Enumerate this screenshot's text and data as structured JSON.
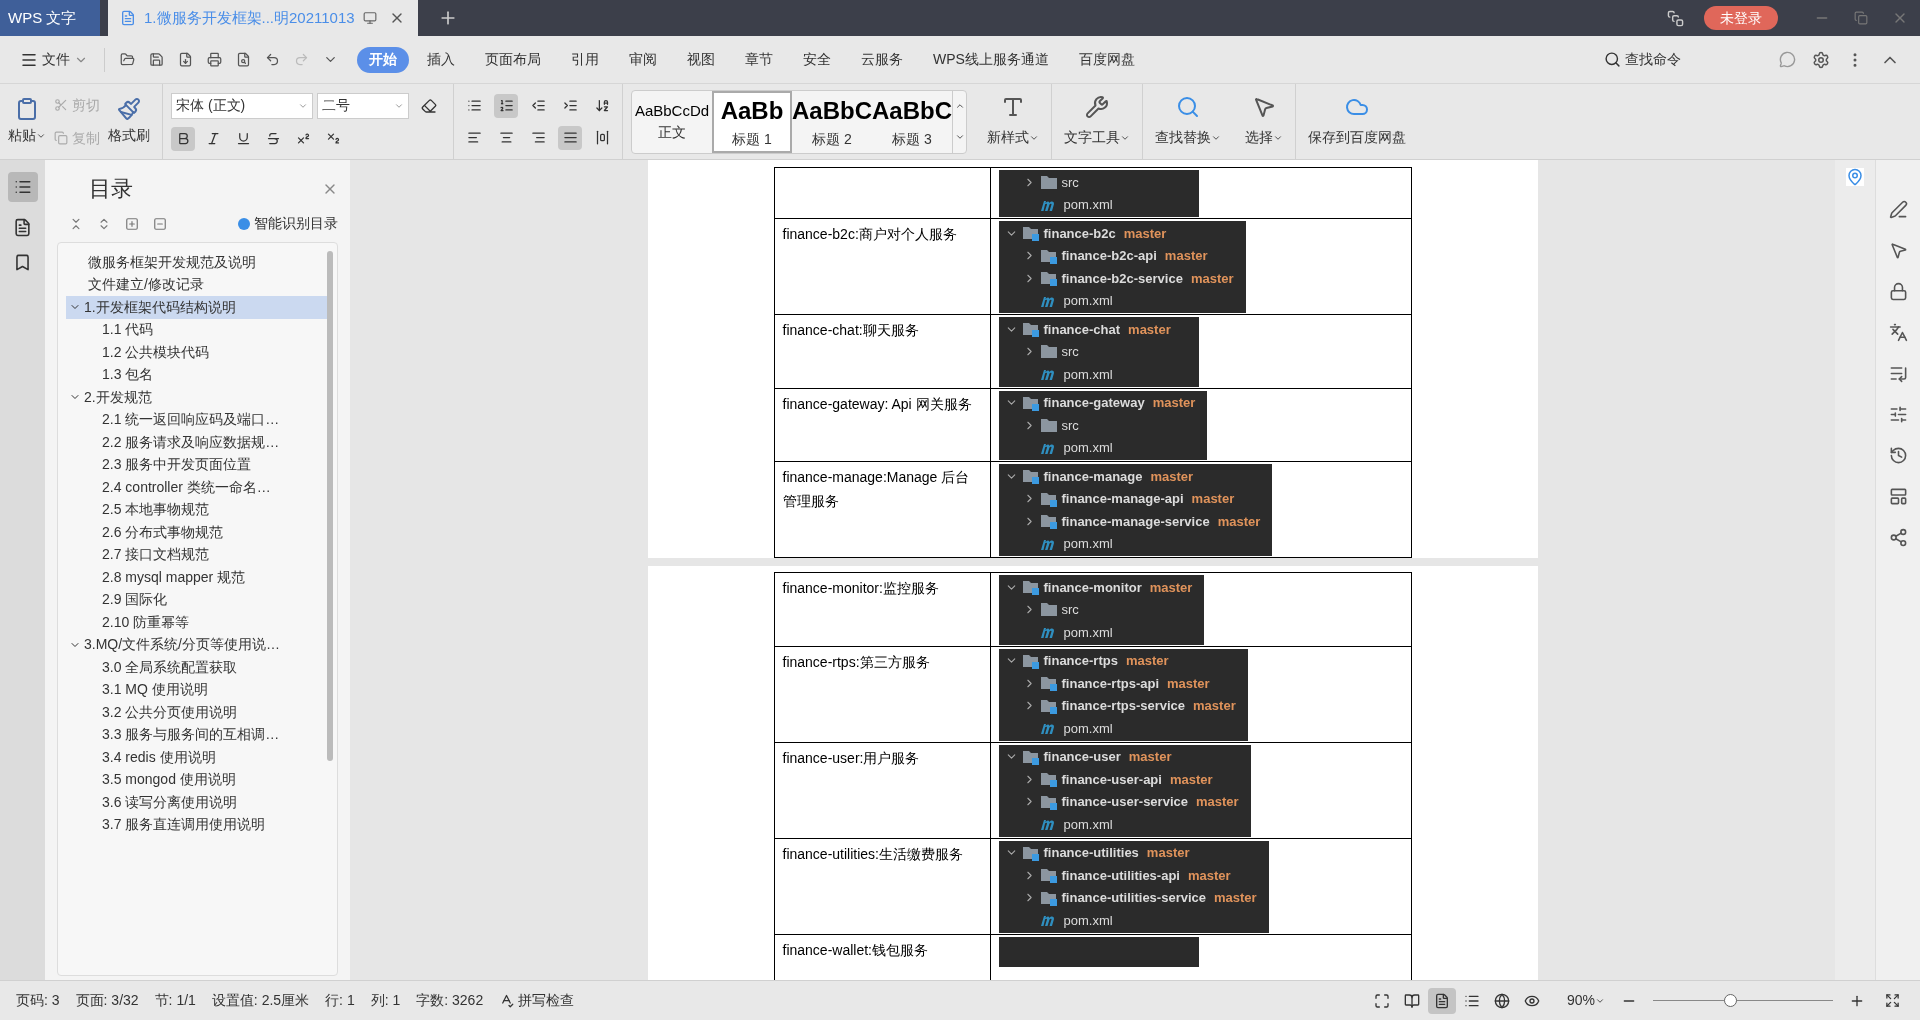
{
  "app_tab": "WPS 文字",
  "doc_tab": {
    "title": "1.微服务开发框架...明20211013"
  },
  "account": "未登录",
  "file_menu": "文件",
  "menu_tabs": [
    {
      "label": "开始",
      "selected": true
    },
    {
      "label": "插入",
      "selected": false
    },
    {
      "label": "页面布局",
      "selected": false
    },
    {
      "label": "引用",
      "selected": false
    },
    {
      "label": "审阅",
      "selected": false
    },
    {
      "label": "视图",
      "selected": false
    },
    {
      "label": "章节",
      "selected": false
    },
    {
      "label": "安全",
      "selected": false
    },
    {
      "label": "云服务",
      "selected": false
    },
    {
      "label": "WPS线上服务通道",
      "selected": false
    },
    {
      "label": "百度网盘",
      "selected": false
    }
  ],
  "search_command": "查找命令",
  "clipboard": [
    {
      "label": "剪切",
      "disabled": true
    },
    {
      "label": "复制",
      "disabled": true
    }
  ],
  "paste": {
    "label": "粘贴",
    "dropdown": true
  },
  "format_painter": {
    "label": "格式刷"
  },
  "font": {
    "family": "宋体 (正文)",
    "size": "二号"
  },
  "format_buttons": [
    {
      "kind": "bold",
      "on": true
    },
    {
      "kind": "italic",
      "on": false
    },
    {
      "kind": "underline",
      "on": false
    },
    {
      "kind": "strike",
      "on": false
    },
    {
      "kind": "superscript",
      "on": false
    },
    {
      "kind": "subscript",
      "on": false
    }
  ],
  "paragraph_buttons": [
    {
      "kind": "bullets",
      "on": false
    },
    {
      "kind": "numbering",
      "on": true
    },
    {
      "kind": "outdent",
      "on": false
    },
    {
      "kind": "indent",
      "on": false
    },
    {
      "kind": "sort",
      "on": false
    }
  ],
  "align_buttons": [
    {
      "kind": "left",
      "on": false
    },
    {
      "kind": "center",
      "on": false
    },
    {
      "kind": "right",
      "on": false
    },
    {
      "kind": "justify",
      "on": true
    },
    {
      "kind": "distribute",
      "on": false
    }
  ],
  "styles": [
    {
      "sample": "AaBbCcDd",
      "name": "正文",
      "kind": "body",
      "selected": false
    },
    {
      "sample": "AaBb",
      "name": "标题 1",
      "kind": "heading",
      "selected": true
    },
    {
      "sample": "AaBbC",
      "name": "标题 2",
      "kind": "heading",
      "selected": false
    },
    {
      "sample": "AaBbC",
      "name": "标题 3",
      "kind": "heading",
      "selected": false
    }
  ],
  "tools": [
    {
      "kind": "new-style",
      "label": "新样式",
      "dropdown": true
    },
    {
      "kind": "text-tools",
      "label": "文字工具",
      "dropdown": true
    },
    {
      "kind": "find",
      "label": "查找替换",
      "dropdown": true
    },
    {
      "kind": "select",
      "label": "选择",
      "dropdown": true
    },
    {
      "kind": "cloud",
      "label": "保存到百度网盘",
      "dropdown": false
    }
  ],
  "nav": {
    "title": "目录",
    "smart": "智能识别目录",
    "items": [
      {
        "label": "微服务框架开发规范及说明",
        "selected": false
      },
      {
        "label": "文件建立/修改记录",
        "selected": false
      },
      {
        "label": "1.开发框架代码结构说明",
        "selected": true,
        "expanded": true,
        "children": [
          {
            "label": "1.1  代码",
            "selected": false
          },
          {
            "label": "1.2  公共模块代码",
            "selected": false
          },
          {
            "label": "1.3  包名",
            "selected": false
          }
        ]
      },
      {
        "label": "2.开发规范",
        "selected": false,
        "expanded": true,
        "children": [
          {
            "label": "2.1  统一返回响应码及端口…",
            "selected": false
          },
          {
            "label": "2.2  服务请求及响应数据规…",
            "selected": false
          },
          {
            "label": "2.3  服务中开发页面位置",
            "selected": false
          },
          {
            "label": "2.4 controller 类统一命名…",
            "selected": false
          },
          {
            "label": "2.5  本地事物规范",
            "selected": false
          },
          {
            "label": "2.6  分布式事物规范",
            "selected": false
          },
          {
            "label": "2.7  接口文档规范",
            "selected": false
          },
          {
            "label": "2.8 mysql mapper 规范",
            "selected": false
          },
          {
            "label": "2.9  国际化",
            "selected": false
          },
          {
            "label": "2.10  防重幂等",
            "selected": false
          }
        ]
      },
      {
        "label": "3.MQ/文件系统/分页等使用说…",
        "selected": false,
        "expanded": true,
        "children": [
          {
            "label": "3.0  全局系统配置获取",
            "selected": false
          },
          {
            "label": "3.1 MQ 使用说明",
            "selected": false
          },
          {
            "label": "3.2  公共分页使用说明",
            "selected": false
          },
          {
            "label": "3.3  服务与服务间的互相调…",
            "selected": false
          },
          {
            "label": "3.4 redis 使用说明",
            "selected": false
          },
          {
            "label": "3.5 mongod 使用说明",
            "selected": false
          },
          {
            "label": "3.6  读写分离使用说明",
            "selected": false
          },
          {
            "label": "3.7  服务直连调用使用说明",
            "selected": false
          }
        ]
      }
    ]
  },
  "pages": [
    {
      "rows": [
        {
          "tree": [
            {
              "kind": "folder",
              "name": "src",
              "expanded": false
            },
            {
              "kind": "file",
              "name": "pom.xml"
            }
          ]
        },
        {
          "label": "finance-b2c:商户对个人服务",
          "tree": [
            {
              "kind": "module",
              "name": "finance-b2c",
              "branch": "master",
              "expanded": true,
              "children": [
                {
                  "kind": "module",
                  "name": "finance-b2c-api",
                  "branch": "master",
                  "expanded": false
                },
                {
                  "kind": "module",
                  "name": "finance-b2c-service",
                  "branch": "master",
                  "expanded": false
                },
                {
                  "kind": "file",
                  "name": "pom.xml"
                }
              ]
            }
          ]
        },
        {
          "label": "finance-chat:聊天服务",
          "tree": [
            {
              "kind": "module",
              "name": "finance-chat",
              "branch": "master",
              "expanded": true,
              "children": [
                {
                  "kind": "folder",
                  "name": "src",
                  "expanded": false
                },
                {
                  "kind": "file",
                  "name": "pom.xml"
                }
              ]
            }
          ]
        },
        {
          "label": "finance-gateway: Api 网关服务",
          "tree": [
            {
              "kind": "module",
              "name": "finance-gateway",
              "branch": "master",
              "expanded": true,
              "children": [
                {
                  "kind": "folder",
                  "name": "src",
                  "expanded": false
                },
                {
                  "kind": "file",
                  "name": "pom.xml"
                }
              ]
            }
          ]
        },
        {
          "label": "finance-manage:Manage 后台管理服务",
          "tree": [
            {
              "kind": "module",
              "name": "finance-manage",
              "branch": "master",
              "expanded": true,
              "children": [
                {
                  "kind": "module",
                  "name": "finance-manage-api",
                  "branch": "master",
                  "expanded": false
                },
                {
                  "kind": "module",
                  "name": "finance-manage-service",
                  "branch": "master",
                  "expanded": false
                },
                {
                  "kind": "file",
                  "name": "pom.xml"
                }
              ]
            }
          ]
        }
      ]
    },
    {
      "rows": [
        {
          "label": "finance-monitor:监控服务",
          "tree": [
            {
              "kind": "module",
              "name": "finance-monitor",
              "branch": "master",
              "expanded": true,
              "children": [
                {
                  "kind": "folder",
                  "name": "src",
                  "expanded": false
                },
                {
                  "kind": "file",
                  "name": "pom.xml"
                }
              ]
            }
          ]
        },
        {
          "label": "finance-rtps:第三方服务",
          "tree": [
            {
              "kind": "module",
              "name": "finance-rtps",
              "branch": "master",
              "expanded": true,
              "children": [
                {
                  "kind": "module",
                  "name": "finance-rtps-api",
                  "branch": "master",
                  "expanded": false
                },
                {
                  "kind": "module",
                  "name": "finance-rtps-service",
                  "branch": "master",
                  "expanded": false
                },
                {
                  "kind": "file",
                  "name": "pom.xml"
                }
              ]
            }
          ]
        },
        {
          "label": "finance-user:用户服务",
          "tree": [
            {
              "kind": "module",
              "name": "finance-user",
              "branch": "master",
              "expanded": true,
              "children": [
                {
                  "kind": "module",
                  "name": "finance-user-api",
                  "branch": "master",
                  "expanded": false
                },
                {
                  "kind": "module",
                  "name": "finance-user-service",
                  "branch": "master",
                  "expanded": false
                },
                {
                  "kind": "file",
                  "name": "pom.xml"
                }
              ]
            }
          ]
        },
        {
          "label": "finance-utilities:生活缴费服务",
          "tree": [
            {
              "kind": "module",
              "name": "finance-utilities",
              "branch": "master",
              "expanded": true,
              "children": [
                {
                  "kind": "module",
                  "name": "finance-utilities-api",
                  "branch": "master",
                  "expanded": false
                },
                {
                  "kind": "module",
                  "name": "finance-utilities-service",
                  "branch": "master",
                  "expanded": false
                },
                {
                  "kind": "file",
                  "name": "pom.xml"
                }
              ]
            }
          ]
        },
        {
          "label": "finance-wallet:钱包服务",
          "tree": []
        }
      ]
    }
  ],
  "status": [
    {
      "text": "页码: 3"
    },
    {
      "text": "页面: 3/32"
    },
    {
      "text": "节: 1/1"
    },
    {
      "text": "设置值: 2.5厘米"
    },
    {
      "text": "行: 1"
    },
    {
      "text": "列: 1"
    },
    {
      "text": "字数: 3262"
    }
  ],
  "spell_check": "拼写检查",
  "views": [
    {
      "kind": "fullscreen",
      "selected": false
    },
    {
      "kind": "book",
      "selected": false
    },
    {
      "kind": "page",
      "selected": true
    },
    {
      "kind": "outline",
      "selected": false
    },
    {
      "kind": "web",
      "selected": false
    },
    {
      "kind": "eye",
      "selected": false
    }
  ],
  "zoom": {
    "text": "90%",
    "level": 0.43
  }
}
